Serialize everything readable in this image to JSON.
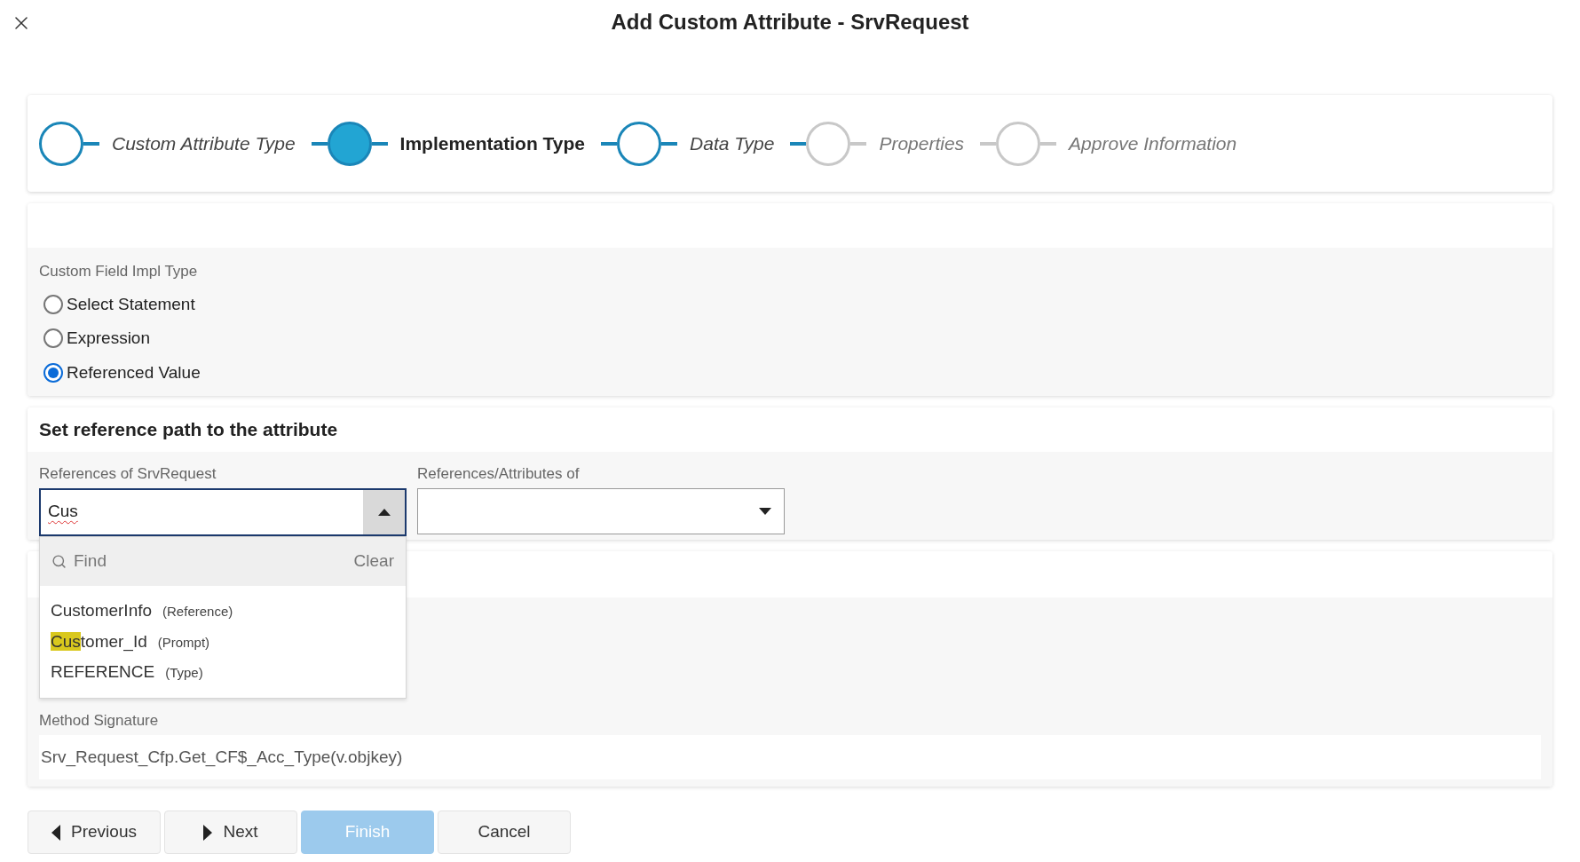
{
  "title": "Add Custom Attribute - SrvRequest",
  "steps": [
    {
      "label": "Custom Attribute Type",
      "reached": true,
      "selected": false
    },
    {
      "label": "Implementation Type",
      "reached": true,
      "selected": true
    },
    {
      "label": "Data Type",
      "reached": true,
      "selected": false
    },
    {
      "label": "Properties",
      "reached": false,
      "selected": false
    },
    {
      "label": "Approve Information",
      "reached": false,
      "selected": false
    }
  ],
  "impl_type": {
    "label": "Custom Field Impl Type",
    "options": [
      {
        "label": "Select Statement",
        "selected": false
      },
      {
        "label": "Expression",
        "selected": false
      },
      {
        "label": "Referenced Value",
        "selected": true
      }
    ]
  },
  "reference_path": {
    "heading": "Set reference path to the attribute",
    "references_field": {
      "label": "References of SrvRequest",
      "value": "Cus",
      "expanded": true
    },
    "attributes_field": {
      "label": "References/Attributes of"
    },
    "dropdown": {
      "search_placeholder": "Find",
      "clear": "Clear",
      "items": [
        {
          "parts": [
            {
              "text": "CustomerInfo",
              "highlighted": false
            }
          ],
          "type": "(Reference)"
        },
        {
          "parts": [
            {
              "text": "Cus",
              "highlighted": true
            },
            {
              "text": "tomer_Id",
              "highlighted": false
            }
          ],
          "type": "(Prompt)"
        },
        {
          "parts": [
            {
              "text": "REFERENCE",
              "highlighted": false
            }
          ],
          "type": "(Type)"
        }
      ]
    }
  },
  "method_signature": {
    "label": "Method Signature",
    "value": "Srv_Request_Cfp.Get_CF$_Acc_Type(v.objkey)"
  },
  "buttons": [
    {
      "label": "Previous",
      "kind": "previous",
      "disabled": false
    },
    {
      "label": "Next",
      "kind": "next",
      "disabled": false
    },
    {
      "label": "Finish",
      "kind": "primary",
      "disabled": true
    },
    {
      "label": "Cancel",
      "kind": "plain",
      "disabled": false
    }
  ]
}
